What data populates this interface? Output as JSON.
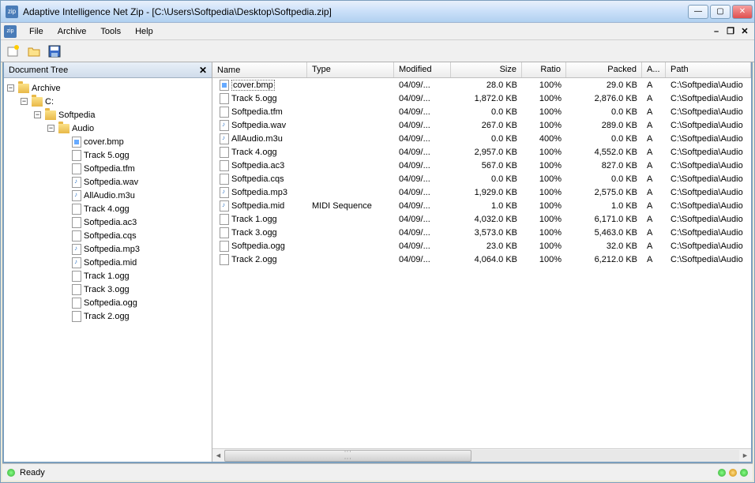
{
  "window": {
    "title": "Adaptive Intelligence Net Zip - [C:\\Users\\Softpedia\\Desktop\\Softpedia.zip]",
    "app_icon_text": "zip"
  },
  "menu": {
    "file": "File",
    "archive": "Archive",
    "tools": "Tools",
    "help": "Help"
  },
  "sidebar": {
    "title": "Document Tree",
    "tree": {
      "root": "Archive",
      "drive": "C:",
      "folder1": "Softpedia",
      "folder2": "Audio",
      "files": [
        {
          "name": "cover.bmp",
          "kind": "image"
        },
        {
          "name": "Track 5.ogg",
          "kind": "file"
        },
        {
          "name": "Softpedia.tfm",
          "kind": "file"
        },
        {
          "name": "Softpedia.wav",
          "kind": "audio"
        },
        {
          "name": "AllAudio.m3u",
          "kind": "audio"
        },
        {
          "name": "Track 4.ogg",
          "kind": "file"
        },
        {
          "name": "Softpedia.ac3",
          "kind": "file"
        },
        {
          "name": "Softpedia.cqs",
          "kind": "file"
        },
        {
          "name": "Softpedia.mp3",
          "kind": "audio"
        },
        {
          "name": "Softpedia.mid",
          "kind": "audio"
        },
        {
          "name": "Track 1.ogg",
          "kind": "file"
        },
        {
          "name": "Track 3.ogg",
          "kind": "file"
        },
        {
          "name": "Softpedia.ogg",
          "kind": "file"
        },
        {
          "name": "Track 2.ogg",
          "kind": "file"
        }
      ]
    }
  },
  "list": {
    "columns": {
      "name": "Name",
      "type": "Type",
      "modified": "Modified",
      "size": "Size",
      "ratio": "Ratio",
      "packed": "Packed",
      "a": "A...",
      "path": "Path"
    },
    "rows": [
      {
        "name": "cover.bmp",
        "type": "",
        "modified": "04/09/...",
        "size": "28.0 KB",
        "ratio": "100%",
        "packed": "29.0 KB",
        "a": "A",
        "path": "C:\\Softpedia\\Audio",
        "kind": "image",
        "selected": true
      },
      {
        "name": "Track 5.ogg",
        "type": "",
        "modified": "04/09/...",
        "size": "1,872.0 KB",
        "ratio": "100%",
        "packed": "2,876.0 KB",
        "a": "A",
        "path": "C:\\Softpedia\\Audio",
        "kind": "file"
      },
      {
        "name": "Softpedia.tfm",
        "type": "",
        "modified": "04/09/...",
        "size": "0.0 KB",
        "ratio": "100%",
        "packed": "0.0 KB",
        "a": "A",
        "path": "C:\\Softpedia\\Audio",
        "kind": "file"
      },
      {
        "name": "Softpedia.wav",
        "type": "",
        "modified": "04/09/...",
        "size": "267.0 KB",
        "ratio": "100%",
        "packed": "289.0 KB",
        "a": "A",
        "path": "C:\\Softpedia\\Audio",
        "kind": "audio"
      },
      {
        "name": "AllAudio.m3u",
        "type": "",
        "modified": "04/09/...",
        "size": "0.0 KB",
        "ratio": "400%",
        "packed": "0.0 KB",
        "a": "A",
        "path": "C:\\Softpedia\\Audio",
        "kind": "audio"
      },
      {
        "name": "Track 4.ogg",
        "type": "",
        "modified": "04/09/...",
        "size": "2,957.0 KB",
        "ratio": "100%",
        "packed": "4,552.0 KB",
        "a": "A",
        "path": "C:\\Softpedia\\Audio",
        "kind": "file"
      },
      {
        "name": "Softpedia.ac3",
        "type": "",
        "modified": "04/09/...",
        "size": "567.0 KB",
        "ratio": "100%",
        "packed": "827.0 KB",
        "a": "A",
        "path": "C:\\Softpedia\\Audio",
        "kind": "file"
      },
      {
        "name": "Softpedia.cqs",
        "type": "",
        "modified": "04/09/...",
        "size": "0.0 KB",
        "ratio": "100%",
        "packed": "0.0 KB",
        "a": "A",
        "path": "C:\\Softpedia\\Audio",
        "kind": "file"
      },
      {
        "name": "Softpedia.mp3",
        "type": "",
        "modified": "04/09/...",
        "size": "1,929.0 KB",
        "ratio": "100%",
        "packed": "2,575.0 KB",
        "a": "A",
        "path": "C:\\Softpedia\\Audio",
        "kind": "audio"
      },
      {
        "name": "Softpedia.mid",
        "type": "MIDI Sequence",
        "modified": "04/09/...",
        "size": "1.0 KB",
        "ratio": "100%",
        "packed": "1.0 KB",
        "a": "A",
        "path": "C:\\Softpedia\\Audio",
        "kind": "audio"
      },
      {
        "name": "Track 1.ogg",
        "type": "",
        "modified": "04/09/...",
        "size": "4,032.0 KB",
        "ratio": "100%",
        "packed": "6,171.0 KB",
        "a": "A",
        "path": "C:\\Softpedia\\Audio",
        "kind": "file"
      },
      {
        "name": "Track 3.ogg",
        "type": "",
        "modified": "04/09/...",
        "size": "3,573.0 KB",
        "ratio": "100%",
        "packed": "5,463.0 KB",
        "a": "A",
        "path": "C:\\Softpedia\\Audio",
        "kind": "file"
      },
      {
        "name": "Softpedia.ogg",
        "type": "",
        "modified": "04/09/...",
        "size": "23.0 KB",
        "ratio": "100%",
        "packed": "32.0 KB",
        "a": "A",
        "path": "C:\\Softpedia\\Audio",
        "kind": "file"
      },
      {
        "name": "Track 2.ogg",
        "type": "",
        "modified": "04/09/...",
        "size": "4,064.0 KB",
        "ratio": "100%",
        "packed": "6,212.0 KB",
        "a": "A",
        "path": "C:\\Softpedia\\Audio",
        "kind": "file"
      }
    ]
  },
  "status": {
    "text": "Ready"
  }
}
